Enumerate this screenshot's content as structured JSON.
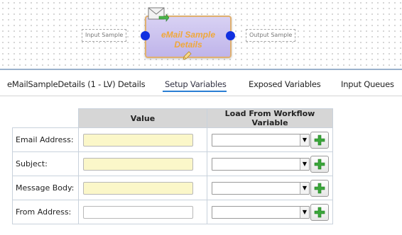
{
  "workflow": {
    "input_label": "Input Sample",
    "output_label": "Output Sample",
    "node_title_line1": "eMail Sample",
    "node_title_line2": "Details",
    "icons": [
      "envelope-icon",
      "pencil-icon"
    ]
  },
  "tabs": [
    {
      "label": "eMailSampleDetails (1 - LV) Details",
      "active": false
    },
    {
      "label": "Setup Variables",
      "active": true
    },
    {
      "label": "Exposed Variables",
      "active": false
    },
    {
      "label": "Input Queues",
      "active": false
    }
  ],
  "table": {
    "headers": {
      "value": "Value",
      "workflow": "Load From Workflow Variable"
    },
    "rows": [
      {
        "label": "Email Address:",
        "value": "",
        "workflow_variable": ""
      },
      {
        "label": "Subject:",
        "value": "",
        "workflow_variable": ""
      },
      {
        "label": "Message Body:",
        "value": "",
        "workflow_variable": ""
      },
      {
        "label": "From Address:",
        "value": "",
        "workflow_variable": ""
      }
    ]
  },
  "colors": {
    "node_fill": "#c8bff0",
    "node_title": "#f0a83a",
    "port": "#1030e0",
    "tab_underline": "#2a7fd4",
    "required_field": "#fbf7c9",
    "add_button_plus": "#3aa63a"
  }
}
